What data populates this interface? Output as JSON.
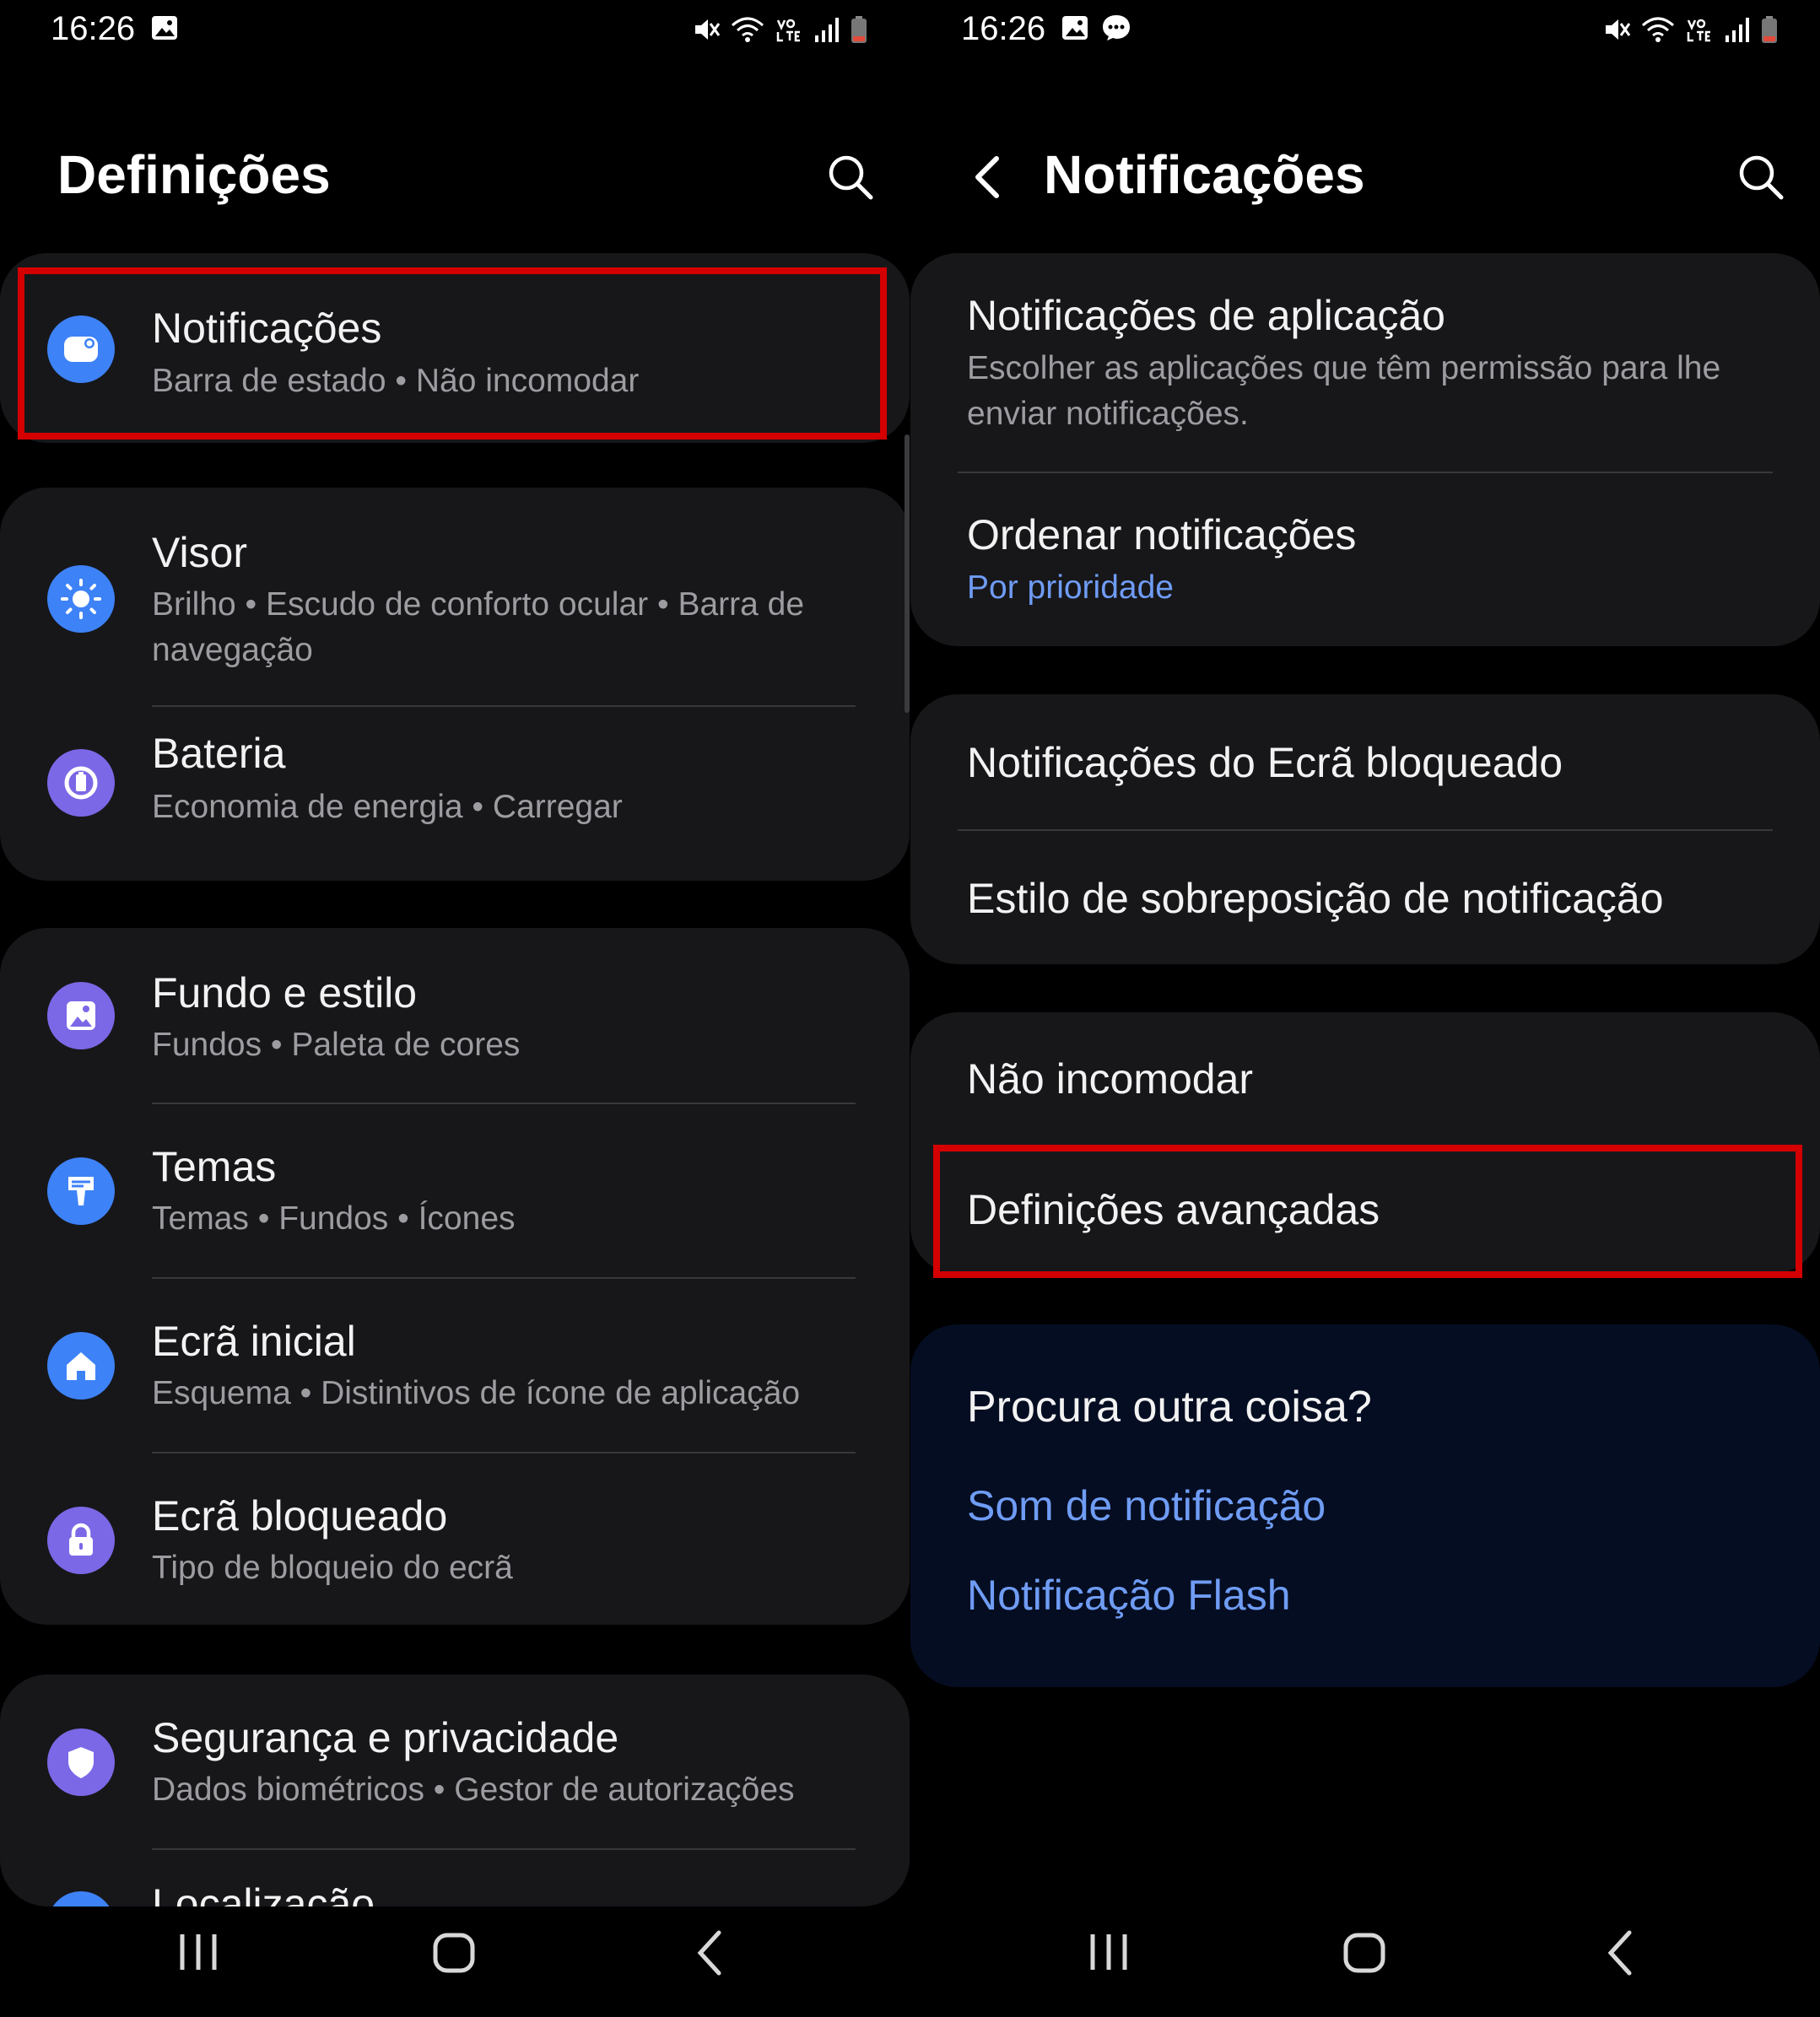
{
  "left": {
    "status": {
      "time": "16:26"
    },
    "header": {
      "title": "Definições"
    },
    "cards": [
      [
        {
          "title": "Notificações",
          "sub": "Barra de estado  •  Não incomodar",
          "icon": "notification-icon",
          "color": "#3e82f7"
        }
      ],
      [
        {
          "title": "Visor",
          "sub": "Brilho  •  Escudo de conforto ocular  •  Barra de navegação",
          "icon": "brightness-icon",
          "color": "#3e82f7"
        },
        {
          "title": "Bateria",
          "sub": "Economia de energia  •  Carregar",
          "icon": "battery-icon",
          "color": "#7b68e6"
        }
      ],
      [
        {
          "title": "Fundo e estilo",
          "sub": "Fundos  •  Paleta de cores",
          "icon": "wallpaper-icon",
          "color": "#7b68e6"
        },
        {
          "title": "Temas",
          "sub": "Temas  •  Fundos  •  Ícones",
          "icon": "themes-icon",
          "color": "#3e82f7"
        },
        {
          "title": "Ecrã inicial",
          "sub": "Esquema  •  Distintivos de ícone de aplicação",
          "icon": "home-icon",
          "color": "#3e82f7"
        },
        {
          "title": "Ecrã bloqueado",
          "sub": "Tipo de bloqueio do ecrã",
          "icon": "lock-icon",
          "color": "#7b68e6"
        }
      ],
      [
        {
          "title": "Segurança e privacidade",
          "sub": "Dados biométricos  •  Gestor de autorizações",
          "icon": "shield-icon",
          "color": "#7b68e6"
        },
        {
          "title": "Localização",
          "sub": "",
          "icon": "location-icon",
          "color": "#3e82f7"
        }
      ]
    ]
  },
  "right": {
    "status": {
      "time": "16:26"
    },
    "header": {
      "title": "Notificações"
    },
    "group1": {
      "app_title": "Notificações de aplicação",
      "app_sub": "Escolher as aplicações que têm permissão para lhe enviar notificações.",
      "order_title": "Ordenar notificações",
      "order_value": "Por prioridade"
    },
    "group2": {
      "lock_title": "Notificações do Ecrã bloqueado",
      "popup_title": "Estilo de sobreposição de notificação"
    },
    "group3": {
      "dnd_title": "Não incomodar",
      "advanced_title": "Definições avançadas"
    },
    "looking": {
      "question": "Procura outra coisa?",
      "link1": "Som de notificação",
      "link2": "Notificação Flash"
    }
  },
  "colors": {
    "highlight": "#d40000",
    "link": "#6f9cf4",
    "card": "#17171a"
  }
}
